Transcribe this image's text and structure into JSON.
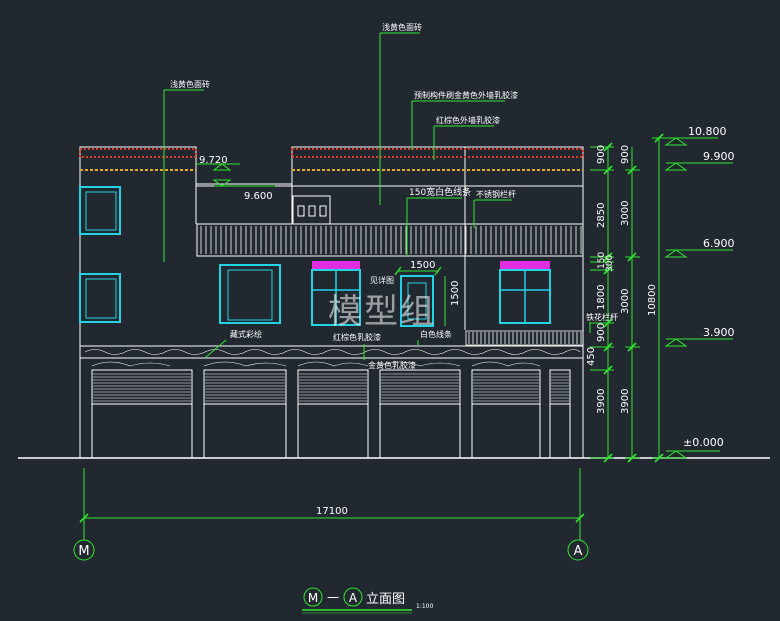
{
  "title": {
    "axis_left": "M",
    "dash": "一",
    "axis_right": "A",
    "text": "立面图",
    "scale": "1:100"
  },
  "axes": {
    "left": "M",
    "right": "A"
  },
  "overall_width": "17100",
  "watermark": "模型组",
  "elevations": [
    "10.800",
    "9.900",
    "6.900",
    "3.900",
    "±0.000"
  ],
  "side_marks": {
    "left_high": "9.720",
    "left_low": "9.600"
  },
  "dims_inner": [
    "900",
    "2850",
    "150",
    "300",
    "1800",
    "900",
    "450",
    "3900"
  ],
  "dims_middle": [
    "900",
    "3000",
    "3000",
    "3900"
  ],
  "dims_outer": [
    "10800"
  ],
  "dims_window": {
    "width": "1500",
    "height": "1500"
  },
  "annotations": {
    "top_center": "浅黄色面砖",
    "left": "浅黄色面砖",
    "component": "预制构件刷金黄色外墙乳胶漆",
    "red_paint": "红棕色外墙乳胶漆",
    "white_band": "150宽白色线条",
    "rail": "不锈钢栏杆",
    "detail": "见详图",
    "iron_rail": "铁花栏杆",
    "tibetan": "藏式彩绘",
    "red_brown": "红棕色乳胶漆",
    "white_line": "白色线条",
    "gold": "金黄色乳胶漆"
  },
  "colors": {
    "background": "#212830",
    "line": "#ffffff",
    "dimension": "#2ee82e",
    "window": "#22d3e6",
    "magenta": "#e22ee2",
    "eave_red": "#e03a2a",
    "eave_gold": "#e0b020"
  }
}
